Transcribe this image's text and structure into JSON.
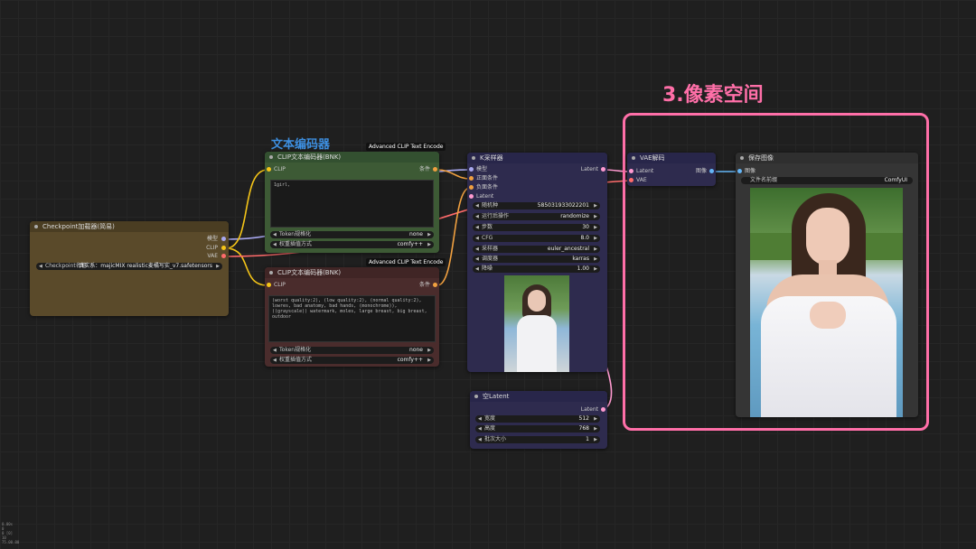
{
  "annotations": {
    "group_label": "文本编码器",
    "pixel_label": "3.像素空间",
    "accent_pink": "#ff6fa8",
    "accent_blue": "#3d8fe0"
  },
  "checkpoint": {
    "title": "Checkpoint加载器(简易)",
    "outputs": [
      "模型",
      "CLIP",
      "VAE"
    ],
    "widget_label": "Checkpoint名称",
    "widget_value": "真实系：majicMIX realistic麦橘写实_v7.safetensors"
  },
  "clip_pos": {
    "badge": "Advanced CLIP Text Encode",
    "title": "CLIP文本编码器(BNK)",
    "input": "CLIP",
    "output": "条件",
    "text": "1girl,",
    "widgets": [
      {
        "label": "Token规格化",
        "value": "none"
      },
      {
        "label": "权重插值方式",
        "value": "comfy++"
      }
    ]
  },
  "clip_neg": {
    "badge": "Advanced CLIP Text Encode",
    "title": "CLIP文本编码器(BNK)",
    "input": "CLIP",
    "output": "条件",
    "text": "(worst quality:2), (low quality:2), (normal quality:2), lowres, bad anatomy, bad hands, (monochrome)), ((grayscale)) watermark, moles, large breast, big breast, outdoor",
    "widgets": [
      {
        "label": "Token规格化",
        "value": "none"
      },
      {
        "label": "权重插值方式",
        "value": "comfy++"
      }
    ]
  },
  "ksampler": {
    "title": "K采样器",
    "inputs": [
      "模型",
      "正面条件",
      "负面条件",
      "Latent"
    ],
    "output": "Latent",
    "widgets": [
      {
        "label": "随机种",
        "value": "585031933022201"
      },
      {
        "label": "运行后操作",
        "value": "randomize"
      },
      {
        "label": "步数",
        "value": "30"
      },
      {
        "label": "CFG",
        "value": "8.0"
      },
      {
        "label": "采样器",
        "value": "euler_ancestral"
      },
      {
        "label": "调度器",
        "value": "karras"
      },
      {
        "label": "降噪",
        "value": "1.00"
      }
    ]
  },
  "latent": {
    "title": "空Latent",
    "output": "Latent",
    "widgets": [
      {
        "label": "宽度",
        "value": "512"
      },
      {
        "label": "高度",
        "value": "768"
      },
      {
        "label": "批次大小",
        "value": "1"
      }
    ]
  },
  "vae": {
    "title": "VAE解码",
    "inputs": [
      "Latent",
      "VAE"
    ],
    "output": "图像"
  },
  "save": {
    "title": "保存图像",
    "input": "图像",
    "widget_label": "文件名前缀",
    "widget_value": "ComfyUI"
  },
  "status": [
    "0.00s",
    "0",
    "0 [0]",
    "10",
    "75.00.00"
  ]
}
